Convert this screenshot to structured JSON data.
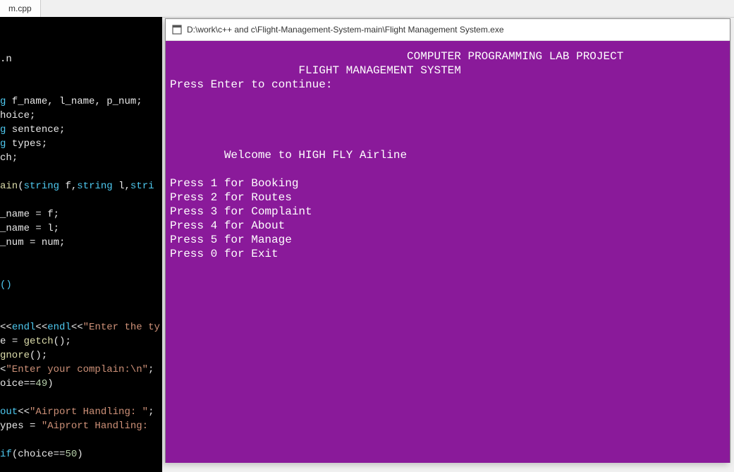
{
  "tab": {
    "name": "m.cpp"
  },
  "code": {
    "lines": [
      {
        "segs": [
          {
            "t": ".n",
            "c": "c-white"
          }
        ]
      },
      {
        "segs": []
      },
      {
        "segs": []
      },
      {
        "segs": [
          {
            "t": "g",
            "c": "c-cyan"
          },
          {
            "t": " f_name",
            "c": "c-white"
          },
          {
            "t": ",",
            "c": "c-white"
          },
          {
            "t": " l_name",
            "c": "c-white"
          },
          {
            "t": ",",
            "c": "c-white"
          },
          {
            "t": " p_num",
            "c": "c-white"
          },
          {
            "t": ";",
            "c": "c-white"
          }
        ]
      },
      {
        "segs": [
          {
            "t": "hoice",
            "c": "c-white"
          },
          {
            "t": ";",
            "c": "c-white"
          }
        ]
      },
      {
        "segs": [
          {
            "t": "g",
            "c": "c-cyan"
          },
          {
            "t": " sentence",
            "c": "c-white"
          },
          {
            "t": ";",
            "c": "c-white"
          }
        ]
      },
      {
        "segs": [
          {
            "t": "g",
            "c": "c-cyan"
          },
          {
            "t": " types",
            "c": "c-white"
          },
          {
            "t": ";",
            "c": "c-white"
          }
        ]
      },
      {
        "segs": [
          {
            "t": "ch",
            "c": "c-white"
          },
          {
            "t": ";",
            "c": "c-white"
          }
        ]
      },
      {
        "segs": []
      },
      {
        "segs": [
          {
            "t": "ain",
            "c": "c-yellow"
          },
          {
            "t": "(",
            "c": "c-white"
          },
          {
            "t": "string",
            "c": "c-cyan"
          },
          {
            "t": " f",
            "c": "c-white"
          },
          {
            "t": ",",
            "c": "c-white"
          },
          {
            "t": "string",
            "c": "c-cyan"
          },
          {
            "t": " l",
            "c": "c-white"
          },
          {
            "t": ",",
            "c": "c-white"
          },
          {
            "t": "stri",
            "c": "c-cyan"
          }
        ]
      },
      {
        "segs": []
      },
      {
        "segs": [
          {
            "t": "_name ",
            "c": "c-white"
          },
          {
            "t": "=",
            "c": "c-white"
          },
          {
            "t": " f",
            "c": "c-white"
          },
          {
            "t": ";",
            "c": "c-white"
          }
        ]
      },
      {
        "segs": [
          {
            "t": "_name ",
            "c": "c-white"
          },
          {
            "t": "=",
            "c": "c-white"
          },
          {
            "t": " l",
            "c": "c-white"
          },
          {
            "t": ";",
            "c": "c-white"
          }
        ]
      },
      {
        "segs": [
          {
            "t": "_num ",
            "c": "c-white"
          },
          {
            "t": "=",
            "c": "c-white"
          },
          {
            "t": " num",
            "c": "c-white"
          },
          {
            "t": ";",
            "c": "c-white"
          }
        ]
      },
      {
        "segs": []
      },
      {
        "segs": []
      },
      {
        "segs": [
          {
            "t": "()",
            "c": "c-cyan"
          }
        ]
      },
      {
        "segs": []
      },
      {
        "segs": []
      },
      {
        "segs": [
          {
            "t": "<<",
            "c": "c-white"
          },
          {
            "t": "endl",
            "c": "c-cyan"
          },
          {
            "t": "<<",
            "c": "c-white"
          },
          {
            "t": "endl",
            "c": "c-cyan"
          },
          {
            "t": "<<",
            "c": "c-white"
          },
          {
            "t": "\"Enter the ty",
            "c": "c-orange"
          }
        ]
      },
      {
        "segs": [
          {
            "t": "e ",
            "c": "c-white"
          },
          {
            "t": "=",
            "c": "c-white"
          },
          {
            "t": " getch",
            "c": "c-yellow"
          },
          {
            "t": "();",
            "c": "c-white"
          }
        ]
      },
      {
        "segs": [
          {
            "t": "gnore",
            "c": "c-yellow"
          },
          {
            "t": "();",
            "c": "c-white"
          }
        ]
      },
      {
        "segs": [
          {
            "t": "<",
            "c": "c-white"
          },
          {
            "t": "\"Enter your complain:\\n\"",
            "c": "c-orange"
          },
          {
            "t": ";",
            "c": "c-white"
          }
        ]
      },
      {
        "segs": [
          {
            "t": "oice",
            "c": "c-white"
          },
          {
            "t": "==",
            "c": "c-white"
          },
          {
            "t": "49",
            "c": "c-lime"
          },
          {
            "t": ")",
            "c": "c-white"
          }
        ]
      },
      {
        "segs": []
      },
      {
        "segs": [
          {
            "t": "out",
            "c": "c-cyan"
          },
          {
            "t": "<<",
            "c": "c-white"
          },
          {
            "t": "\"Airport Handling: \"",
            "c": "c-orange"
          },
          {
            "t": ";",
            "c": "c-white"
          }
        ]
      },
      {
        "segs": [
          {
            "t": "ypes ",
            "c": "c-white"
          },
          {
            "t": "=",
            "c": "c-white"
          },
          {
            "t": " \"Aiprort Handling:",
            "c": "c-orange"
          }
        ]
      },
      {
        "segs": []
      },
      {
        "segs": [
          {
            "t": "if",
            "c": "c-cyan"
          },
          {
            "t": "(",
            "c": "c-white"
          },
          {
            "t": "choice",
            "c": "c-white"
          },
          {
            "t": "==",
            "c": "c-white"
          },
          {
            "t": "50",
            "c": "c-lime"
          },
          {
            "t": ")",
            "c": "c-white"
          }
        ]
      }
    ]
  },
  "console": {
    "title": "D:\\work\\c++ and c\\Flight-Management-System-main\\Flight Management System.exe",
    "header1": "COMPUTER PROGRAMMING LAB PROJECT",
    "header2": "FLIGHT MANAGEMENT SYSTEM",
    "prompt": "Press Enter to continue:",
    "welcome": "Welcome to HIGH FLY Airline",
    "menu": [
      "Press 1 for Booking",
      "Press 2 for Routes",
      "Press 3 for Complaint",
      "Press 4 for About",
      "Press 5 for Manage",
      "Press 0 for Exit"
    ]
  }
}
